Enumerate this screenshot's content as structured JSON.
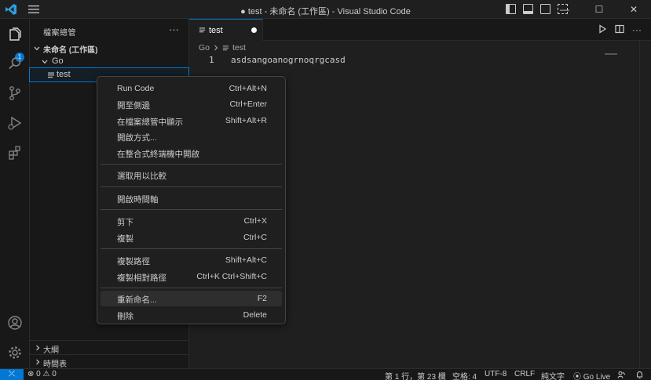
{
  "window": {
    "title": "● test - 未命名 (工作區) - Visual Studio Code",
    "controls": {
      "minimize": "—",
      "maximize": "☐",
      "close": "✕"
    }
  },
  "colors": {
    "accent": "#0078d4",
    "background": "#1f1f1f",
    "sidebar": "#181818"
  },
  "activity_bar": {
    "items": [
      "files-icon",
      "search-icon",
      "source-control-icon",
      "run-debug-icon",
      "extensions-icon"
    ],
    "explorer_badge": "1",
    "bottom": [
      "account-icon",
      "manage-gear-icon"
    ]
  },
  "sidebar": {
    "header": "檔案總管",
    "more": "···",
    "workspace": "未命名 (工作區)",
    "folder": "Go",
    "file": "test",
    "outline": "大綱",
    "timeline": "時間表"
  },
  "editor": {
    "tab_label": "test",
    "breadcrumb": {
      "folder": "Go",
      "file": "test"
    },
    "line_number": "1",
    "line_text": "asdsangoanogrnoqrgcasd"
  },
  "context_menu": {
    "groups": [
      [
        {
          "label": "Run Code",
          "key": "Ctrl+Alt+N"
        },
        {
          "label": "開至側邊",
          "key": "Ctrl+Enter"
        },
        {
          "label": "在檔案總管中顯示",
          "key": "Shift+Alt+R"
        },
        {
          "label": "開啟方式...",
          "key": ""
        },
        {
          "label": "在整合式終端機中開啟",
          "key": ""
        }
      ],
      [
        {
          "label": "選取用以比較",
          "key": ""
        }
      ],
      [
        {
          "label": "開啟時間軸",
          "key": ""
        }
      ],
      [
        {
          "label": "剪下",
          "key": "Ctrl+X"
        },
        {
          "label": "複製",
          "key": "Ctrl+C"
        }
      ],
      [
        {
          "label": "複製路徑",
          "key": "Shift+Alt+C"
        },
        {
          "label": "複製相對路徑",
          "key": "Ctrl+K Ctrl+Shift+C"
        }
      ],
      [
        {
          "label": "重新命名...",
          "key": "F2"
        },
        {
          "label": "刪除",
          "key": "Delete"
        }
      ]
    ],
    "highlighted": "重新命名..."
  },
  "status_bar": {
    "remote": "⤫",
    "errors": "0",
    "warnings": "0",
    "position": "第 1 行，第 23 欄",
    "spaces": "空格: 4",
    "encoding": "UTF-8",
    "eol": "CRLF",
    "language": "純文字",
    "go_live": "Go Live"
  }
}
